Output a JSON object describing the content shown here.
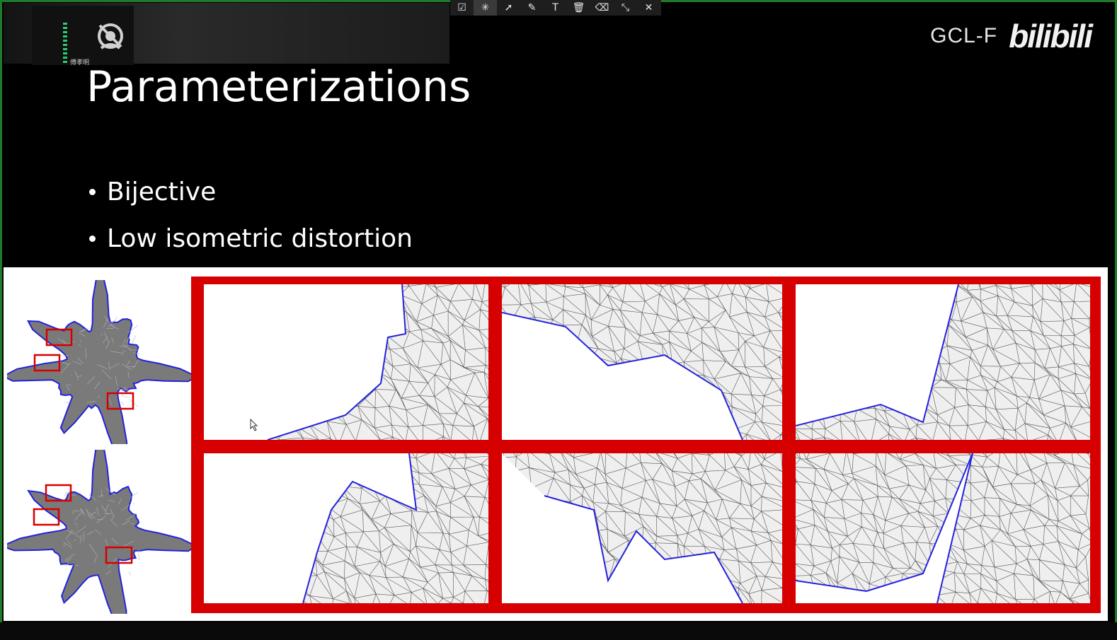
{
  "meeting": {
    "participant_name": "傅孝明"
  },
  "toolbar": {
    "tools": [
      {
        "icon": "checkbox-icon",
        "glyph": "☑"
      },
      {
        "icon": "laser-pointer-icon",
        "glyph": "✳"
      },
      {
        "icon": "select-arrow-icon",
        "glyph": "➚"
      },
      {
        "icon": "pen-icon",
        "glyph": "✎"
      },
      {
        "icon": "text-icon",
        "glyph": "T"
      },
      {
        "icon": "trash-icon",
        "glyph": "🗑"
      },
      {
        "icon": "clear-all-icon",
        "glyph": "⌫"
      },
      {
        "icon": "collapse-icon",
        "glyph": "⤡"
      },
      {
        "icon": "close-icon",
        "glyph": "✕"
      }
    ]
  },
  "brand": {
    "channel": "GCL-F",
    "logo_text": "bilibili"
  },
  "slide": {
    "title": "Parameterizations",
    "bullets": [
      "Bijective",
      "Low isometric distortion"
    ]
  },
  "colors": {
    "frame": "#d60000",
    "boundary": "#2222dd",
    "mesh_line": "#555555",
    "mesh_fill": "#efefef",
    "window_border": "#1f7a2a"
  }
}
